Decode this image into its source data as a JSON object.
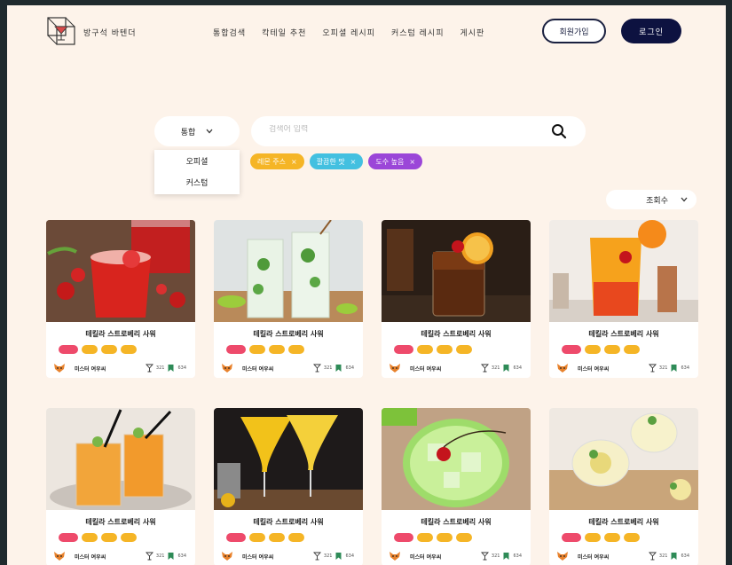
{
  "header": {
    "brand": "방구석 바텐더",
    "nav": [
      "통합검색",
      "칵테일 추천",
      "오피셜 레시피",
      "커스텀 레시피",
      "게시판"
    ],
    "join_label": "회원가입",
    "login_label": "로그인"
  },
  "search": {
    "category_selected": "통합",
    "placeholder": "검색어 입력",
    "dropdown_options": [
      "오피셜",
      "커스텀"
    ],
    "filter_chips": [
      {
        "label": "레몬 주스",
        "color": "#f5b526"
      },
      {
        "label": "깔끔한 맛",
        "color": "#43c0e0"
      },
      {
        "label": "도수 높음",
        "color": "#9b46d8"
      }
    ],
    "sort_selected": "조회수"
  },
  "colors": {
    "accent_navy": "#0d1240",
    "tag_red": "#ee4a6b",
    "tag_yellow": "#f5b526",
    "bookmark_green": "#2e8b57"
  },
  "cards": [
    {
      "title": "테킬라 스트로베리 사워",
      "author": "미스터 여우씨",
      "likes": "321",
      "saves": "634",
      "image": "strawberry-sour-photo"
    },
    {
      "title": "테킬라 스트로베리 사워",
      "author": "미스터 여우씨",
      "likes": "321",
      "saves": "634",
      "image": "mojito-photo"
    },
    {
      "title": "테킬라 스트로베리 사워",
      "author": "미스터 여우씨",
      "likes": "321",
      "saves": "634",
      "image": "whiskey-sour-photo"
    },
    {
      "title": "테킬라 스트로베리 사워",
      "author": "미스터 여우씨",
      "likes": "321",
      "saves": "634",
      "image": "tequila-sunrise-photo"
    },
    {
      "title": "테킬라 스트로베리 사워",
      "author": "미스터 여우씨",
      "likes": "321",
      "saves": "634",
      "image": "iced-tea-cocktail-photo"
    },
    {
      "title": "테킬라 스트로베리 사워",
      "author": "미스터 여우씨",
      "likes": "321",
      "saves": "634",
      "image": "mango-cocktail-photo"
    },
    {
      "title": "테킬라 스트로베리 사워",
      "author": "미스터 여우씨",
      "likes": "321",
      "saves": "634",
      "image": "melon-cherry-cocktail-photo"
    },
    {
      "title": "테킬라 스트로베리 사워",
      "author": "미스터 여우씨",
      "likes": "321",
      "saves": "634",
      "image": "lemon-mint-cocktail-photo"
    }
  ]
}
